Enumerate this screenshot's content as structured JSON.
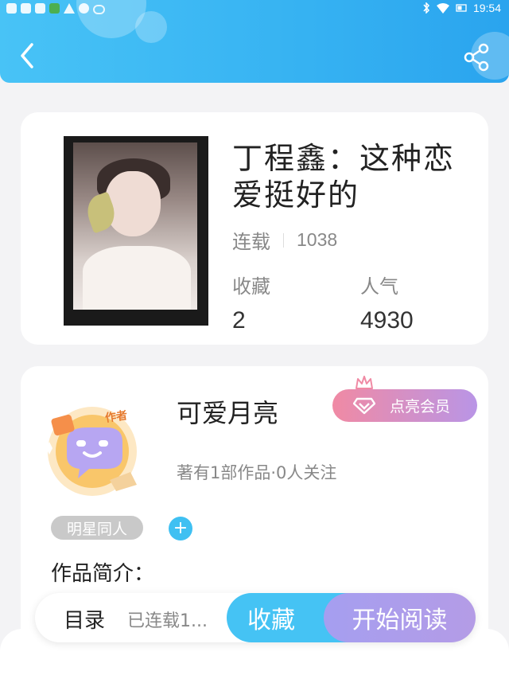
{
  "status_bar": {
    "time": "19:54"
  },
  "book": {
    "title": "丁程鑫：这种恋爱挺好的",
    "status": "连载",
    "count": "1038",
    "favorites_label": "收藏",
    "favorites_value": "2",
    "popularity_label": "人气",
    "popularity_value": "4930"
  },
  "author": {
    "name": "可爱月亮",
    "vip_label": "点亮会员",
    "meta": "著有1部作品·0人关注",
    "badge_text": "作者"
  },
  "tags": [
    {
      "label": "明星同人"
    }
  ],
  "add_tag_symbol": "+",
  "intro_label": "作品简介：",
  "bottom": {
    "toc_label": "目录",
    "toc_status": "已连载1...",
    "favorite_label": "收藏",
    "read_label": "开始阅读"
  },
  "colors": {
    "header": "#36b2f2",
    "accent": "#45c3f4",
    "read_button": "#a59ef0",
    "vip_button": "#f08aa4"
  }
}
